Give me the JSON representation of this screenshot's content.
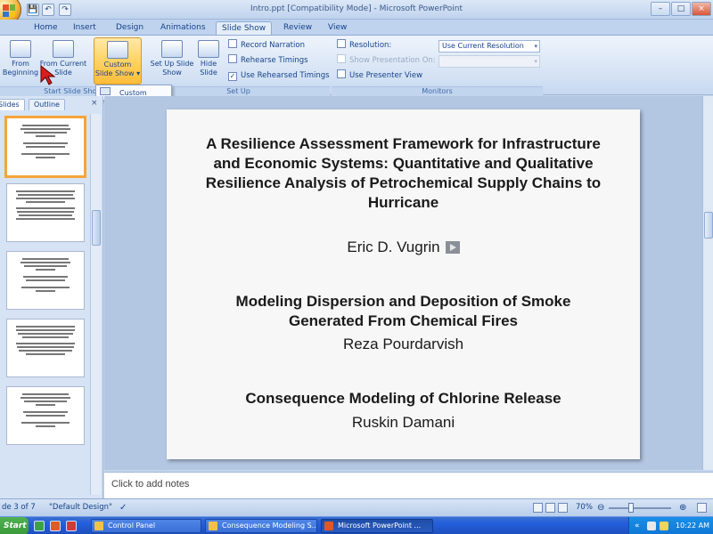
{
  "window": {
    "title": "Intro.ppt [Compatibility Mode] - Microsoft PowerPoint",
    "controls": {
      "minimize": "–",
      "maximize": "□",
      "close": "×"
    }
  },
  "quick_access": {
    "save": "💾",
    "undo": "↶",
    "redo": "↷"
  },
  "tabs": [
    {
      "label": "Home",
      "active": false
    },
    {
      "label": "Insert",
      "active": false
    },
    {
      "label": "Design",
      "active": false
    },
    {
      "label": "Animations",
      "active": false
    },
    {
      "label": "Slide Show",
      "active": true
    },
    {
      "label": "Review",
      "active": false
    },
    {
      "label": "View",
      "active": false
    }
  ],
  "ribbon": {
    "start_group": {
      "label": "Start Slide Show",
      "from_beginning": "From Beginning",
      "from_current": "From Current Slide",
      "custom_show": "Custom Slide Show ▾"
    },
    "setup_group": {
      "label": "Set Up",
      "setup_show": "Set Up Slide Show",
      "hide_slide": "Hide Slide",
      "record_narration": "Record Narration",
      "rehearse_timings": "Rehearse Timings",
      "use_rehearsed": "Use Rehearsed Timings",
      "use_rehearsed_checked": true
    },
    "monitors_group": {
      "label": "Monitors",
      "resolution_label": "Resolution:",
      "resolution_value": "Use Current Resolution",
      "show_on_label": "Show Presentation On:",
      "show_on_value": "",
      "presenter_view": "Use Presenter View",
      "presenter_view_checked": false
    },
    "custom_menu_item": "Custom Shows..."
  },
  "pane": {
    "tab_slides": "Slides",
    "tab_outline": "Outline",
    "close": "×",
    "thumbnails": [
      {
        "selected": true
      },
      {
        "selected": false
      },
      {
        "selected": false
      },
      {
        "selected": false
      },
      {
        "selected": false
      }
    ]
  },
  "slide": {
    "talks": [
      {
        "title": "A Resilience Assessment Framework for Infrastructure and Economic Systems: Quantitative and Qualitative Resilience Analysis of Petrochemical Supply Chains to Hurricane",
        "speaker": "Eric D. Vugrin"
      },
      {
        "title": "Modeling Dispersion and Deposition of Smoke Generated From Chemical Fires",
        "speaker": "Reza Pourdarvish"
      },
      {
        "title": "Consequence Modeling of Chlorine Release",
        "speaker": "Ruskin Damani"
      }
    ]
  },
  "notes": {
    "placeholder": "Click to add notes"
  },
  "status": {
    "slide_count": "de 3 of 7",
    "theme": "\"Default Design\"",
    "zoom": "70%",
    "zoom_level": 0.35,
    "zoom_minus": "⊖",
    "zoom_plus": "⊕"
  },
  "taskbar": {
    "start": "Start",
    "tasks": [
      {
        "label": "Control Panel",
        "active": false
      },
      {
        "label": "Consequence Modeling S...",
        "active": false
      },
      {
        "label": "Microsoft PowerPoint ...",
        "active": true
      }
    ],
    "clock": "10:22 AM"
  },
  "colors": {
    "accent": "#15428b",
    "ribbon_hot": "#ffd56a",
    "thumb_selected": "#f5a53a",
    "taskbar": "#245edb"
  }
}
